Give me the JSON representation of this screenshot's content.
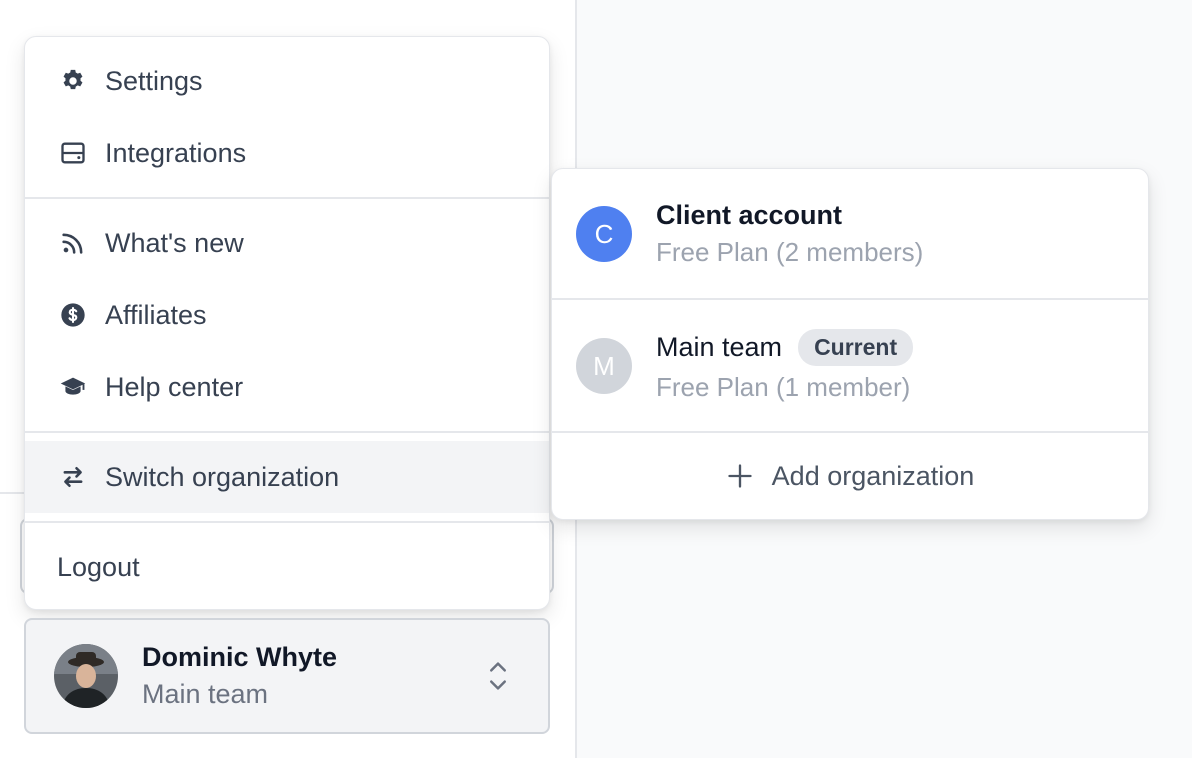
{
  "menu": {
    "items": [
      {
        "label": "Settings",
        "icon": "gear-icon"
      },
      {
        "label": "Integrations",
        "icon": "server-icon"
      },
      {
        "label": "What's new",
        "icon": "rss-icon"
      },
      {
        "label": "Affiliates",
        "icon": "dollar-circle-icon"
      },
      {
        "label": "Help center",
        "icon": "graduation-cap-icon"
      },
      {
        "label": "Switch organization",
        "icon": "switch-arrows-icon"
      },
      {
        "label": "Logout"
      }
    ]
  },
  "organizations": {
    "items": [
      {
        "initial": "C",
        "name": "Client account",
        "plan": "Free Plan (2 members)",
        "avatar_color": "#4f80f0"
      },
      {
        "initial": "M",
        "name": "Main team",
        "badge": "Current",
        "plan": "Free Plan (1 member)",
        "avatar_color": "#d1d5db"
      }
    ],
    "add_label": "Add organization"
  },
  "user": {
    "name": "Dominic Whyte",
    "org": "Main team"
  },
  "colors": {
    "active_bg": "#f3f4f6",
    "accent": "#4f80f0"
  }
}
